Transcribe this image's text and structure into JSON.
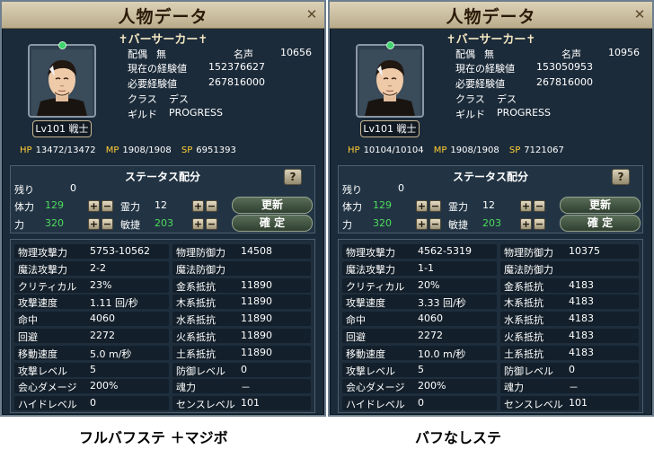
{
  "colors": {
    "panel_bg": "#1c2b3a",
    "title_bar": "#dcd2b6",
    "status_value": "#4ddc5a",
    "hp_label": "#ffcf33"
  },
  "panels": [
    {
      "title": "人物データ",
      "char_name": "✝バーサーカー✝",
      "level": "Lv101 戦士",
      "spouse_label": "配偶",
      "spouse": "無",
      "fame_label": "名声",
      "fame": "10656",
      "exp_label": "現在の経験値",
      "exp": "152376627",
      "need_exp_label": "必要経験値",
      "need_exp": "267816000",
      "class_label": "クラス",
      "class_name": "デス",
      "guild_label": "ギルド",
      "guild": "PROGRESS",
      "hp_label": "HP",
      "hp": "13472/13472",
      "mp_label": "MP",
      "mp": "1908/1908",
      "sp_label": "SP",
      "sp": "6951393",
      "status_title": "ステータス配分",
      "remain_label": "残り",
      "remain": "0",
      "vit_label": "体力",
      "vit": "129",
      "spi_label": "霊力",
      "spi": "12",
      "str_label": "力",
      "str": "320",
      "agi_label": "敏捷",
      "agi": "203",
      "update_button": "更新",
      "confirm_button": "確 定",
      "stats": [
        [
          "物理攻撃力",
          "5753-10562",
          "物理防御力",
          "14508"
        ],
        [
          "魔法攻撃力",
          "2-2",
          "魔法防御力",
          ""
        ],
        [
          "クリティカル",
          "23%",
          "金系抵抗",
          "11890"
        ],
        [
          "攻撃速度",
          "1.11 回/秒",
          "木系抵抗",
          "11890"
        ],
        [
          "命中",
          "4060",
          "水系抵抗",
          "11890"
        ],
        [
          "回避",
          "2272",
          "火系抵抗",
          "11890"
        ],
        [
          "移動速度",
          "5.0 m/秒",
          "土系抵抗",
          "11890"
        ],
        [
          "攻撃レベル",
          "5",
          "防御レベル",
          "0"
        ],
        [
          "会心ダメージ",
          "200%",
          "魂力",
          "－"
        ],
        [
          "ハイドレベル",
          "0",
          "センスレベル",
          "101"
        ]
      ]
    },
    {
      "title": "人物データ",
      "char_name": "✝バーサーカー✝",
      "level": "Lv101 戦士",
      "spouse_label": "配偶",
      "spouse": "無",
      "fame_label": "名声",
      "fame": "10956",
      "exp_label": "現在の経験値",
      "exp": "153050953",
      "need_exp_label": "必要経験値",
      "need_exp": "267816000",
      "class_label": "クラス",
      "class_name": "デス",
      "guild_label": "ギルド",
      "guild": "PROGRESS",
      "hp_label": "HP",
      "hp": "10104/10104",
      "mp_label": "MP",
      "mp": "1908/1908",
      "sp_label": "SP",
      "sp": "7121067",
      "status_title": "ステータス配分",
      "remain_label": "残り",
      "remain": "0",
      "vit_label": "体力",
      "vit": "129",
      "spi_label": "霊力",
      "spi": "12",
      "str_label": "力",
      "str": "320",
      "agi_label": "敏捷",
      "agi": "203",
      "update_button": "更新",
      "confirm_button": "確 定",
      "stats": [
        [
          "物理攻撃力",
          "4562-5319",
          "物理防御力",
          "10375"
        ],
        [
          "魔法攻撃力",
          "1-1",
          "魔法防御力",
          ""
        ],
        [
          "クリティカル",
          "20%",
          "金系抵抗",
          "4183"
        ],
        [
          "攻撃速度",
          "3.33 回/秒",
          "木系抵抗",
          "4183"
        ],
        [
          "命中",
          "4060",
          "水系抵抗",
          "4183"
        ],
        [
          "回避",
          "2272",
          "火系抵抗",
          "4183"
        ],
        [
          "移動速度",
          "10.0 m/秒",
          "土系抵抗",
          "4183"
        ],
        [
          "攻撃レベル",
          "5",
          "防御レベル",
          "0"
        ],
        [
          "会心ダメージ",
          "200%",
          "魂力",
          "－"
        ],
        [
          "ハイドレベル",
          "0",
          "センスレベル",
          "101"
        ]
      ]
    }
  ],
  "captions": [
    "フルバフステ ＋マジボ",
    "バフなしステ"
  ],
  "icons": {
    "close": "close-icon",
    "help": "help-icon",
    "plus": "plus-icon",
    "minus": "minus-icon"
  }
}
